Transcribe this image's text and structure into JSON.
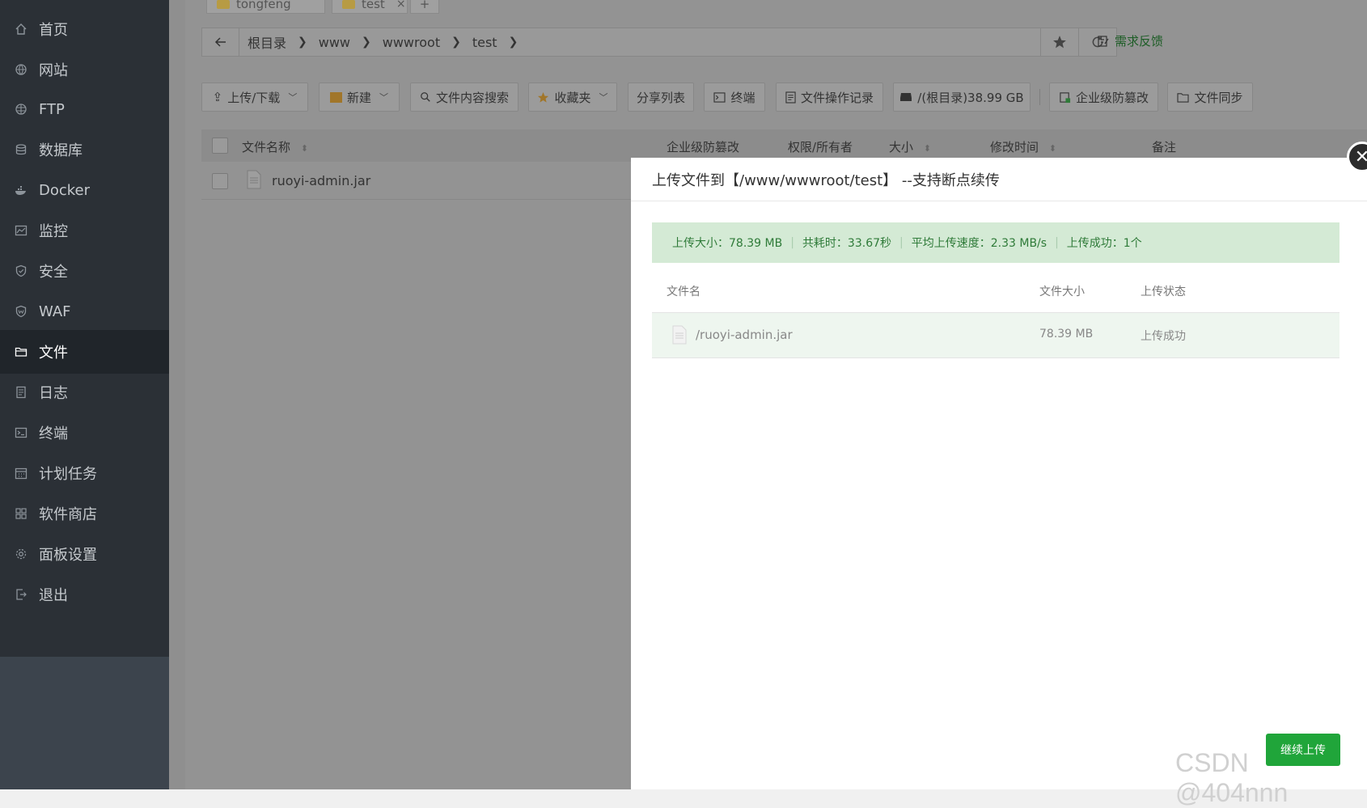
{
  "sidebar": {
    "items": [
      {
        "label": "首页",
        "icon": "home-icon"
      },
      {
        "label": "网站",
        "icon": "globe-icon"
      },
      {
        "label": "FTP",
        "icon": "ftp-globe-icon"
      },
      {
        "label": "数据库",
        "icon": "database-icon"
      },
      {
        "label": "Docker",
        "icon": "docker-icon"
      },
      {
        "label": "监控",
        "icon": "monitor-icon"
      },
      {
        "label": "安全",
        "icon": "shield-icon"
      },
      {
        "label": "WAF",
        "icon": "waf-shield-icon"
      },
      {
        "label": "文件",
        "icon": "folder-icon",
        "active": true
      },
      {
        "label": "日志",
        "icon": "log-icon"
      },
      {
        "label": "终端",
        "icon": "terminal-icon"
      },
      {
        "label": "计划任务",
        "icon": "calendar-icon"
      },
      {
        "label": "软件商店",
        "icon": "grid-icon"
      },
      {
        "label": "面板设置",
        "icon": "gear-icon"
      },
      {
        "label": "退出",
        "icon": "logout-icon"
      }
    ]
  },
  "tabs": [
    {
      "label": "tongfeng"
    },
    {
      "label": "test",
      "close": "×"
    },
    {
      "label": "+"
    }
  ],
  "breadcrumb": [
    "根目录",
    "www",
    "wwwroot",
    "test"
  ],
  "feedback_label": "需求反馈",
  "toolbar": {
    "upload": "上传/下载",
    "new": "新建",
    "search": "文件内容搜索",
    "favorites": "收藏夹",
    "share_list": "分享列表",
    "terminal": "终端",
    "op_log": "文件操作记录",
    "disk": "/(根目录)38.99 GB",
    "tamper": "企业级防篡改",
    "sync": "文件同步"
  },
  "table": {
    "headers": {
      "name": "文件名称",
      "tamper": "企业级防篡改",
      "perm": "权限/所有者",
      "size": "大小",
      "mtime": "修改时间",
      "note": "备注"
    },
    "rows": [
      {
        "name": "ruoyi-admin.jar"
      }
    ]
  },
  "modal": {
    "title": "上传文件到【/www/wwwroot/test】 --支持断点续传",
    "summary": {
      "size": "上传大小：78.39 MB",
      "time": "共耗时：33.67秒",
      "speed": "平均上传速度：2.33 MB/s",
      "success": "上传成功：1个"
    },
    "headers": {
      "name": "文件名",
      "size": "文件大小",
      "status": "上传状态"
    },
    "files": [
      {
        "name": "/ruoyi-admin.jar",
        "size": "78.39 MB",
        "status": "上传成功"
      }
    ],
    "continue_label": "继续上传",
    "close_glyph": "✕"
  },
  "watermark": "CSDN @404nnn",
  "colors": {
    "accent": "#20a53a",
    "sidebar": "#2b3036",
    "summary_bg": "#d4ead5"
  }
}
